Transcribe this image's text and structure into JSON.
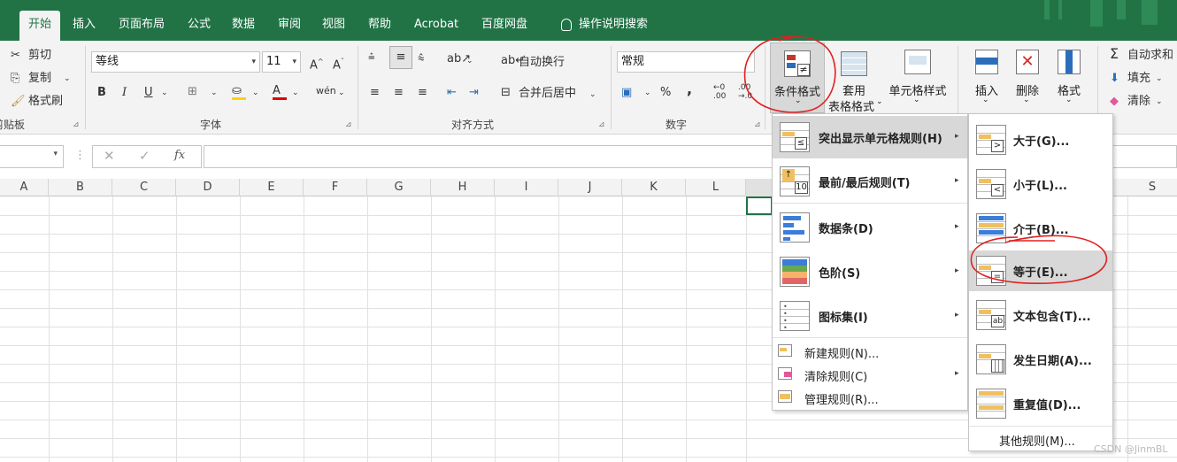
{
  "tabs": [
    "开始",
    "插入",
    "页面布局",
    "公式",
    "数据",
    "审阅",
    "视图",
    "帮助",
    "Acrobat",
    "百度网盘"
  ],
  "tell_me": "操作说明搜索",
  "clipboard": {
    "cut": "剪切",
    "copy": "复制",
    "format_painter": "格式刷",
    "group": "剪贴板"
  },
  "font": {
    "name": "等线",
    "size": "11",
    "group": "字体"
  },
  "alignment": {
    "wrap": "自动换行",
    "merge": "合并后居中",
    "group": "对齐方式"
  },
  "number": {
    "format": "常规",
    "group": "数字"
  },
  "styles": {
    "conditional": "条件格式",
    "table_line1": "套用",
    "table_line2": "表格格式",
    "cell_styles": "单元格样式"
  },
  "cells": {
    "insert": "插入",
    "delete": "删除",
    "format": "格式"
  },
  "editing": {
    "autosum": "自动求和",
    "fill": "填充",
    "clear": "清除"
  },
  "formula_bar": {
    "fx": "fx"
  },
  "columns": [
    "A",
    "B",
    "C",
    "D",
    "E",
    "F",
    "G",
    "H",
    "I",
    "J",
    "K",
    "L",
    "S"
  ],
  "cf_menu": {
    "items": [
      {
        "label": "突出显示单元格规则(H)"
      },
      {
        "label": "最前/最后规则(T)"
      },
      {
        "label": "数据条(D)"
      },
      {
        "label": "色阶(S)"
      },
      {
        "label": "图标集(I)"
      }
    ],
    "small_items": [
      {
        "label": "新建规则(N)..."
      },
      {
        "label": "清除规则(C)"
      },
      {
        "label": "管理规则(R)..."
      }
    ]
  },
  "sub_menu": {
    "items": [
      {
        "label": "大于(G)..."
      },
      {
        "label": "小于(L)..."
      },
      {
        "label": "介于(B)..."
      },
      {
        "label": "等于(E)..."
      },
      {
        "label": "文本包含(T)..."
      },
      {
        "label": "发生日期(A)..."
      },
      {
        "label": "重复值(D)..."
      }
    ],
    "other": "其他规则(M)..."
  },
  "watermark": "CSDN @JinmBL",
  "colors": {
    "accent": "#217346",
    "highlight": "#d8d8d8",
    "annotation": "#e02020"
  }
}
